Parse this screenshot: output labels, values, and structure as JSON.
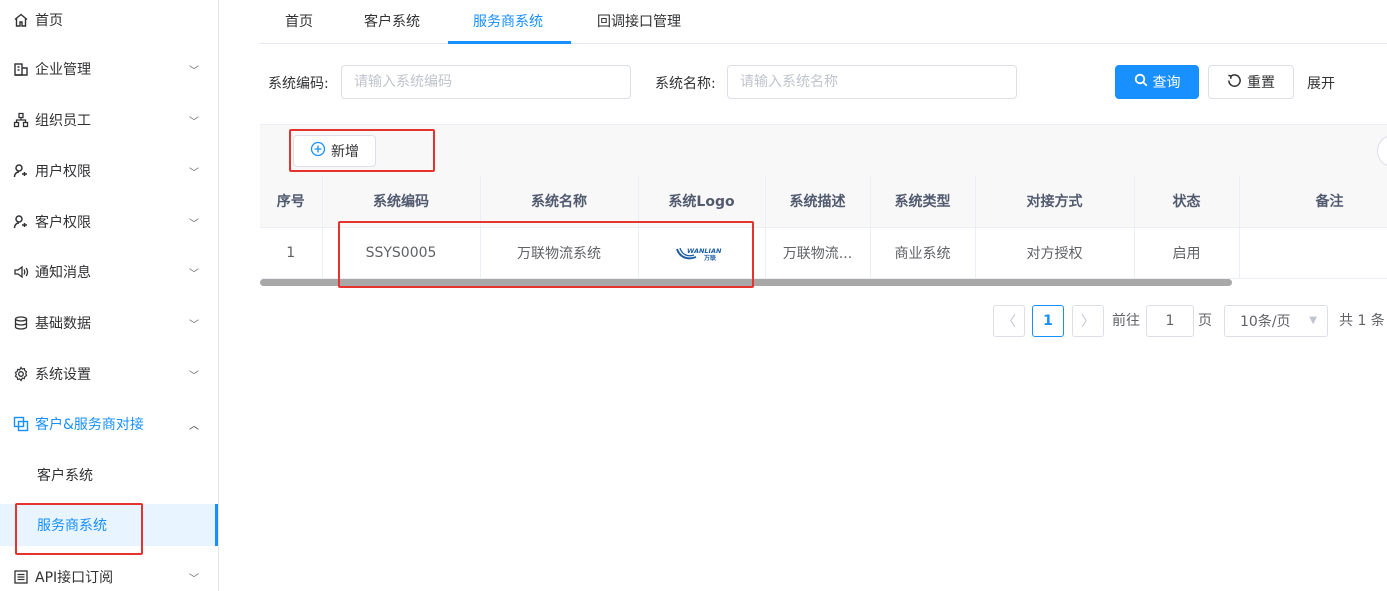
{
  "sidebar": {
    "items": [
      {
        "label": "首页",
        "icon": "home-icon"
      },
      {
        "label": "企业管理",
        "icon": "building-icon"
      },
      {
        "label": "组织员工",
        "icon": "org-chart-icon"
      },
      {
        "label": "用户权限",
        "icon": "user-key-icon"
      },
      {
        "label": "客户权限",
        "icon": "user-key-icon"
      },
      {
        "label": "通知消息",
        "icon": "speaker-icon"
      },
      {
        "label": "基础数据",
        "icon": "database-icon"
      },
      {
        "label": "系统设置",
        "icon": "gear-icon"
      },
      {
        "label": "客户&服务商对接",
        "icon": "link-window-icon"
      },
      {
        "label": "API接口订阅",
        "icon": "list-doc-icon"
      }
    ],
    "subitems": [
      {
        "label": "客户系统"
      },
      {
        "label": "服务商系统"
      }
    ]
  },
  "tabs": [
    "首页",
    "客户系统",
    "服务商系统",
    "回调接口管理"
  ],
  "active_tab": "服务商系统",
  "search": {
    "code_label": "系统编码:",
    "code_placeholder": "请输入系统编码",
    "code_value": "",
    "name_label": "系统名称:",
    "name_placeholder": "请输入系统名称",
    "name_value": "",
    "query_label": "查询",
    "reset_label": "重置",
    "expand_label": "展开"
  },
  "toolbar": {
    "add_label": "新增"
  },
  "table": {
    "columns": [
      "序号",
      "系统编码",
      "系统名称",
      "系统Logo",
      "系统描述",
      "系统类型",
      "对接方式",
      "状态",
      "备注"
    ],
    "rows": [
      {
        "index": "1",
        "code": "SSYS0005",
        "name": "万联物流系统",
        "logo_text": "WANLIAN",
        "logo_sub": "万联",
        "desc": "万联物流...",
        "type": "商业系统",
        "method": "对方授权",
        "status": "启用",
        "remark": ""
      }
    ]
  },
  "pagination": {
    "current_page": "1",
    "goto_prefix": "前往",
    "goto_value": "1",
    "goto_suffix": "页",
    "page_size": "10条/页",
    "total": "共 1 条"
  },
  "colors": {
    "accent": "#1890ff",
    "highlight": "#e5342f"
  }
}
